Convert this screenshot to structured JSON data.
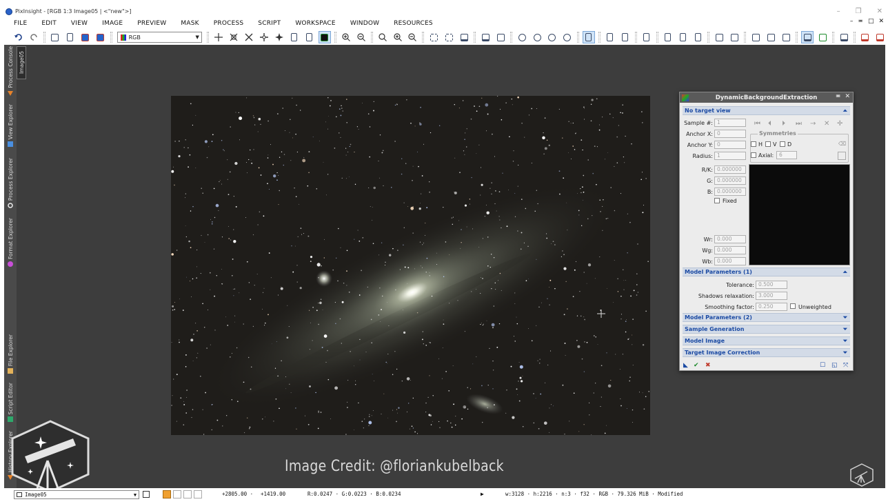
{
  "window": {
    "title": "PixInsight - [RGB 1:3 Image05 | <\"new\">]",
    "controls": [
      "–",
      "❐",
      "✕"
    ]
  },
  "menu": [
    "FILE",
    "EDIT",
    "VIEW",
    "IMAGE",
    "PREVIEW",
    "MASK",
    "PROCESS",
    "SCRIPT",
    "WORKSPACE",
    "WINDOW",
    "RESOURCES"
  ],
  "mdi_controls": [
    "–",
    "≖",
    "□",
    "✕"
  ],
  "toolbar": {
    "color_mode": "RGB"
  },
  "sidebar_tabs": {
    "process_console": "Process Console",
    "view_explorer": "View Explorer",
    "process_explorer": "Process Explorer",
    "format_explorer": "Format Explorer",
    "file_explorer": "File Explorer",
    "script_editor": "Script Editor",
    "history_explorer": "History Explorer"
  },
  "image_tab": "Image05",
  "credit": "Image Credit: @floriankubelback",
  "dbe": {
    "title": "DynamicBackgroundExtraction",
    "no_target": "No target view",
    "sample_label": "Sample #:",
    "sample_value": "1",
    "anchor_x_label": "Anchor X:",
    "anchor_x_value": "0",
    "anchor_y_label": "Anchor Y:",
    "anchor_y_value": "0",
    "radius_label": "Radius:",
    "radius_value": "1",
    "symmetries": "Symmetries",
    "sym_h": "H",
    "sym_v": "V",
    "sym_d": "D",
    "axial_label": "Axial:",
    "axial_value": "6",
    "rk_label": "R/K:",
    "rk_value": "0.000000",
    "g_label": "G:",
    "g_value": "0.000000",
    "b_label": "B:",
    "b_value": "0.000000",
    "fixed": "Fixed",
    "wr_label": "Wr:",
    "wr_value": "0.000",
    "wg_label": "Wg:",
    "wg_value": "0.000",
    "wb_label": "Wb:",
    "wb_value": "0.000",
    "model_params_1": "Model Parameters (1)",
    "tolerance_label": "Tolerance:",
    "tolerance_value": "0.500",
    "shadows_label": "Shadows relaxation:",
    "shadows_value": "3.000",
    "smoothing_label": "Smoothing factor:",
    "smoothing_value": "0.250",
    "unweighted": "Unweighted",
    "model_params_2": "Model Parameters (2)",
    "sample_generation": "Sample Generation",
    "model_image": "Model Image",
    "target_correction": "Target Image Correction"
  },
  "status": {
    "view": "Image05",
    "x": "+2805.00 ·",
    "y": "+1419.00",
    "rgb": "R:0.0247 · G:0.0223 · B:0.0234",
    "info": "w:3128 · h:2216 · n:3 · f32 · RGB · 79.326 MiB · Modified"
  }
}
